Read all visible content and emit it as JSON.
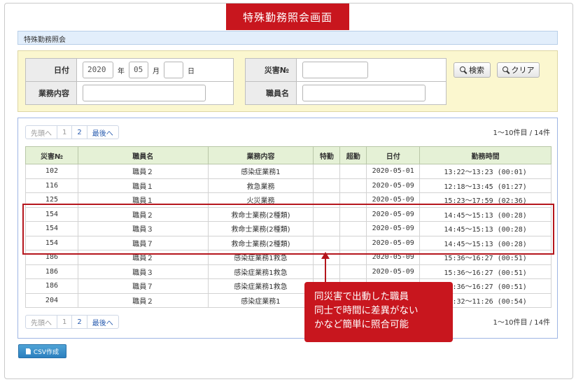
{
  "banner": {
    "title": "特殊勤務照会画面"
  },
  "subheader": {
    "title": "特殊勤務照会"
  },
  "search": {
    "date_label": "日付",
    "year_value": "2020",
    "year_unit": "年",
    "month_value": "05",
    "month_unit": "月",
    "day_value": "",
    "day_unit": "日",
    "disaster_label": "災害№",
    "disaster_value": "",
    "work_label": "業務内容",
    "work_value": "",
    "staff_label": "職員名",
    "staff_value": "",
    "search_button": "検索",
    "clear_button": "クリア"
  },
  "pager": {
    "first": "先頭へ",
    "page1": "1",
    "page2": "2",
    "last": "最後へ",
    "count": "1〜10件目 / 14件"
  },
  "table": {
    "headers": [
      "災害№",
      "職員名",
      "業務内容",
      "特勤",
      "超勤",
      "日付",
      "勤務時間"
    ],
    "rows": [
      [
        "102",
        "職員２",
        "感染症業務1",
        "",
        "",
        "2020-05-01",
        "13:22〜13:23 (00:01)"
      ],
      [
        "116",
        "職員１",
        "救急業務",
        "",
        "",
        "2020-05-09",
        "12:18〜13:45 (01:27)"
      ],
      [
        "125",
        "職員１",
        "火災業務",
        "",
        "",
        "2020-05-09",
        "15:23〜17:59 (02:36)"
      ],
      [
        "154",
        "職員２",
        "救命士業務(2種類)",
        "",
        "",
        "2020-05-09",
        "14:45〜15:13 (00:28)"
      ],
      [
        "154",
        "職員３",
        "救命士業務(2種類)",
        "",
        "",
        "2020-05-09",
        "14:45〜15:13 (00:28)"
      ],
      [
        "154",
        "職員７",
        "救命士業務(2種類)",
        "",
        "",
        "2020-05-09",
        "14:45〜15:13 (00:28)"
      ],
      [
        "186",
        "職員２",
        "感染症業務1救急",
        "",
        "",
        "2020-05-09",
        "15:36〜16:27 (00:51)"
      ],
      [
        "186",
        "職員３",
        "感染症業務1救急",
        "",
        "",
        "2020-05-09",
        "15:36〜16:27 (00:51)"
      ],
      [
        "186",
        "職員７",
        "感染症業務1救急",
        "",
        "",
        "2020-05-09",
        "15:36〜16:27 (00:51)"
      ],
      [
        "204",
        "職員２",
        "感染症業務1",
        "",
        "",
        "2020-05-09",
        "10:32〜11:26 (00:54)"
      ]
    ]
  },
  "callout": {
    "line1": "同災害で出動した職員",
    "line2": "同士で時間に差異がない",
    "line3": "かなど簡単に照合可能"
  },
  "csv_button": "CSV作成",
  "colors": {
    "accent_red": "#c8161e",
    "header_green": "#e5f1d6",
    "search_yellow": "#fbf7cf"
  }
}
